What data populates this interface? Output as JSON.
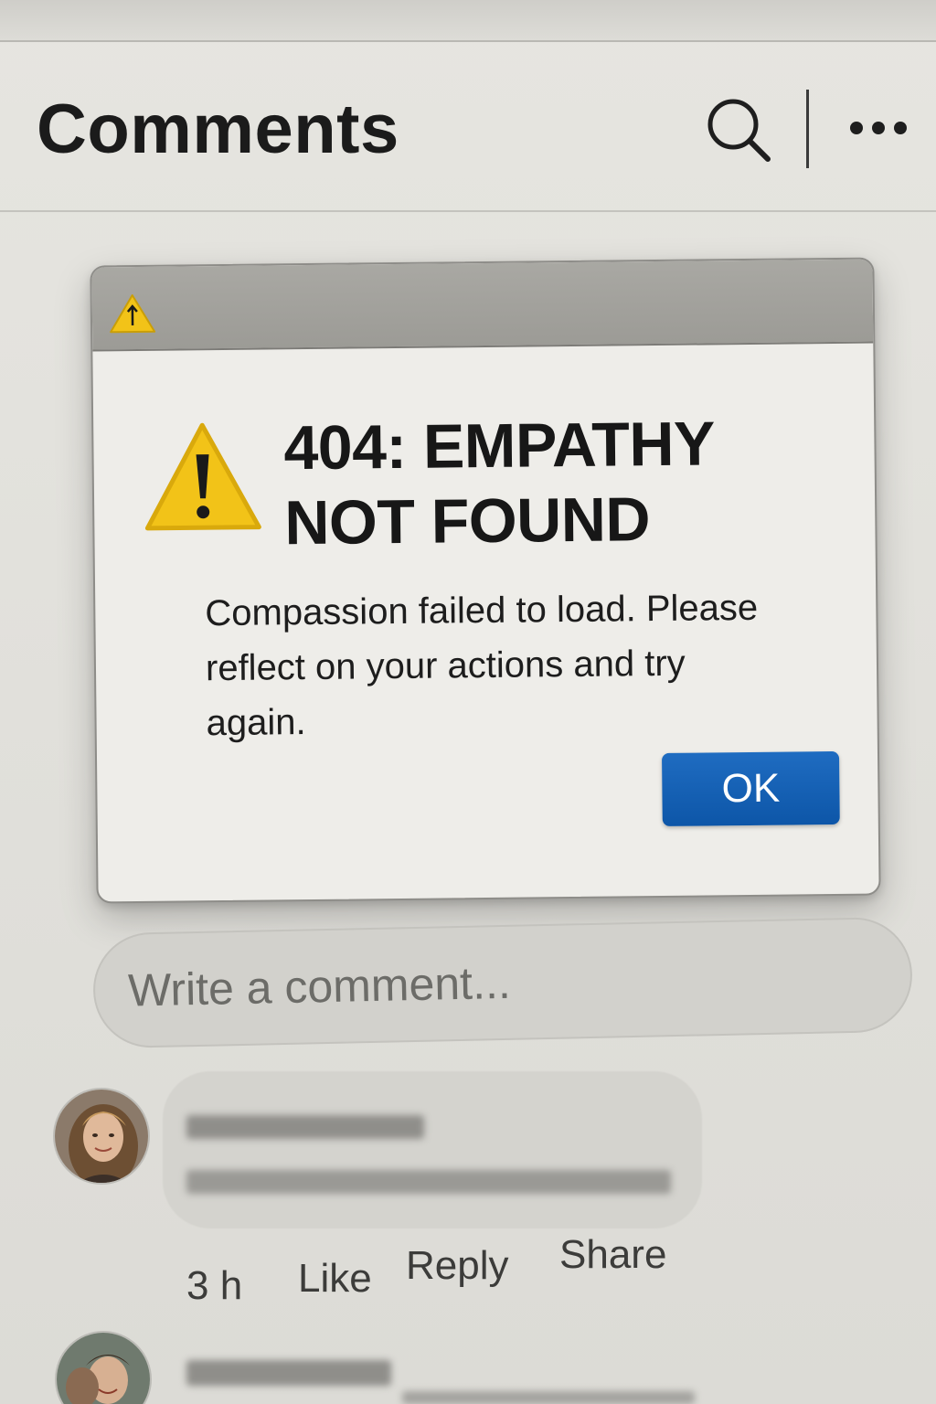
{
  "header": {
    "title": "Comments",
    "search_icon": "search-icon",
    "more_icon": "more-options-icon"
  },
  "dialog": {
    "titlebar_icon": "warning-icon",
    "icon": "warning-icon",
    "heading": "404: EMPATHY NOT FOUND",
    "message": "Compassion failed to load. Please reflect on your actions and try again.",
    "ok_label": "OK",
    "colors": {
      "warning": "#f2c318",
      "button": "#0d56a8"
    }
  },
  "comment_box": {
    "placeholder": "Write a comment..."
  },
  "comments": [
    {
      "timestamp": "3 h",
      "actions": [
        "Like",
        "Reply",
        "Share"
      ]
    }
  ]
}
